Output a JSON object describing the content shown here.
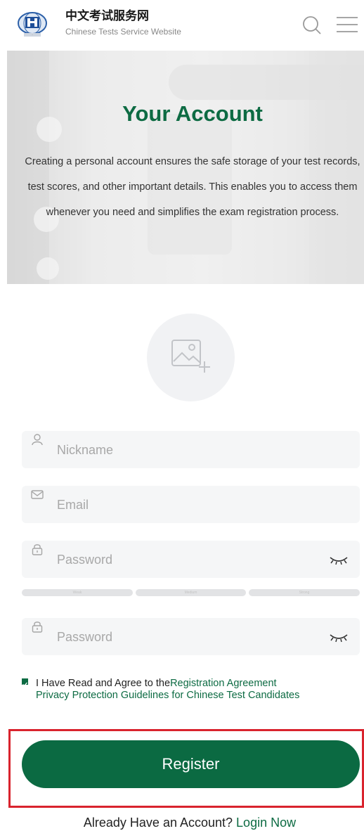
{
  "header": {
    "title_cn": "中文考试服务网",
    "title_en": "Chinese Tests Service Website",
    "logo_icon": "hanban-globe-logo",
    "search_icon": "search-icon",
    "menu_icon": "hamburger-menu-icon"
  },
  "hero": {
    "title": "Your Account",
    "description": "Creating a personal account ensures the safe storage of your test records, test scores, and other important details. This enables you to access them whenever you need and simplifies the exam registration process."
  },
  "avatar": {
    "icon": "image-add-icon"
  },
  "form": {
    "nickname_placeholder": "Nickname",
    "email_placeholder": "Email",
    "password_placeholder": "Password",
    "confirm_password_placeholder": "Password",
    "strength_levels": [
      "Weak",
      "Medium",
      "Strong"
    ]
  },
  "agreement": {
    "prefix": "I Have Read and Agree to the",
    "link1": "Registration Agreement",
    "link2": "Privacy Protection Guidelines for Chinese Test Candidates",
    "checked": true
  },
  "register_label": "Register",
  "login": {
    "prompt": "Already Have an Account?",
    "link": "Login Now"
  },
  "colors": {
    "brand_green": "#0b6a42",
    "highlight_red": "#d9232d",
    "field_bg": "#f5f6f7"
  }
}
